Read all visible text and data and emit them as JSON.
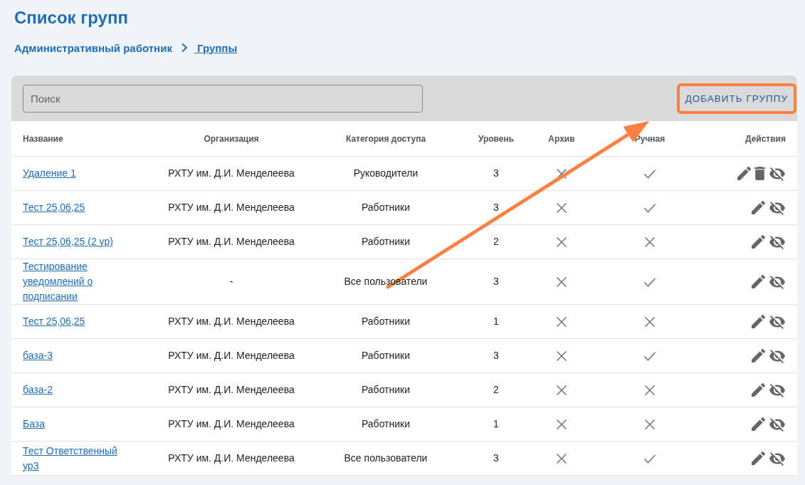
{
  "title": "Список групп",
  "breadcrumbs": [
    {
      "label": "Административный работник",
      "kind": "text"
    },
    {
      "label": " Группы",
      "kind": "link"
    }
  ],
  "search": {
    "placeholder": "Поиск"
  },
  "add_button": {
    "label": "ДОБАВИТЬ ГРУППУ",
    "highlighted": true
  },
  "arrow_annotation": true,
  "columns": [
    "Название",
    "Организация",
    "Категория доступа",
    "Уровень",
    "Архив",
    "Ручная",
    "Действия"
  ],
  "rows": [
    {
      "name": "Удаление 1",
      "organization": "РХТУ им. Д.И. Менделеева",
      "category": "Руководители",
      "tier": "3",
      "archived": false,
      "manual": true,
      "can_delete": true
    },
    {
      "name": "Тест 25,06,25",
      "organization": "РХТУ им. Д.И. Менделеева",
      "category": "Работники",
      "tier": "3",
      "archived": false,
      "manual": true,
      "can_delete": false
    },
    {
      "name": "Тест 25,06,25 (2 ур)",
      "organization": "РХТУ им. Д.И. Менделеева",
      "category": "Работники",
      "tier": "2",
      "archived": false,
      "manual": false,
      "can_delete": false
    },
    {
      "name": "Тестирование уведомлений о подписании",
      "organization": "-",
      "category": "Все пользователи",
      "tier": "3",
      "archived": false,
      "manual": true,
      "can_delete": false
    },
    {
      "name": "Тест 25,06,25",
      "organization": "РХТУ им. Д.И. Менделеева",
      "category": "Работники",
      "tier": "1",
      "archived": false,
      "manual": false,
      "can_delete": false
    },
    {
      "name": "база-3",
      "organization": "РХТУ им. Д.И. Менделеева",
      "category": "Работники",
      "tier": "3",
      "archived": false,
      "manual": true,
      "can_delete": false
    },
    {
      "name": "база-2",
      "organization": "РХТУ им. Д.И. Менделеева",
      "category": "Работники",
      "tier": "2",
      "archived": false,
      "manual": false,
      "can_delete": false
    },
    {
      "name": "База",
      "organization": "РХТУ им. Д.И. Менделеева",
      "category": "Работники",
      "tier": "1",
      "archived": false,
      "manual": false,
      "can_delete": false
    },
    {
      "name": "Тест Ответственный ур3",
      "organization": "РХТУ им. Д.И. Менделеева",
      "category": "Все пользователи",
      "tier": "3",
      "archived": false,
      "manual": true,
      "can_delete": false
    }
  ]
}
